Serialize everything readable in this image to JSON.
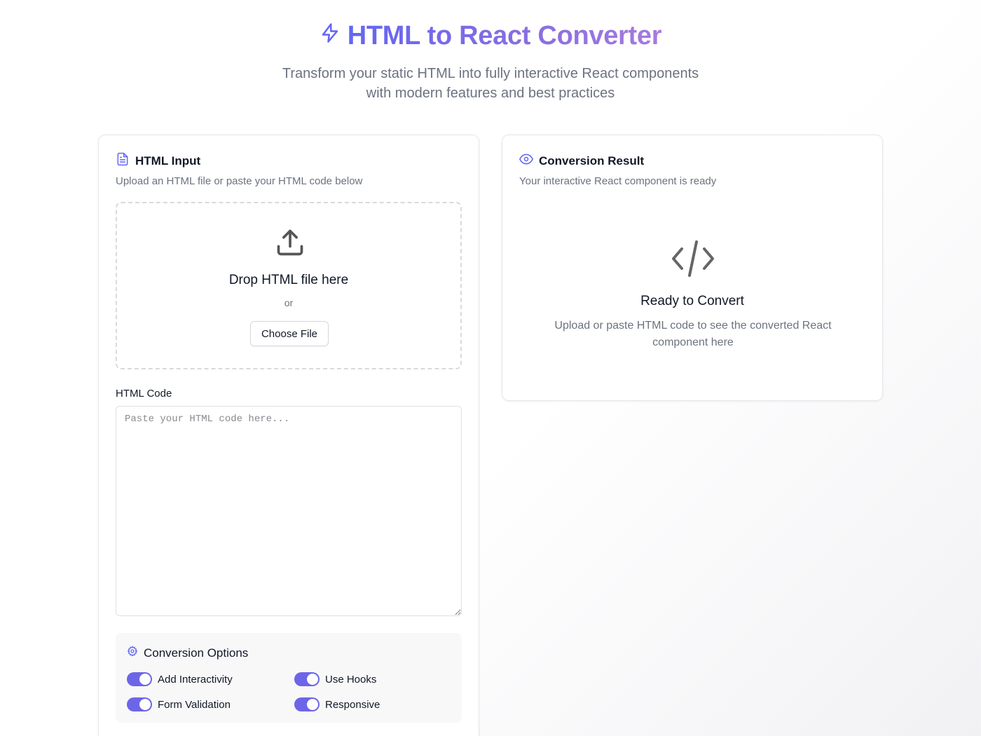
{
  "header": {
    "title": "HTML to React Converter",
    "subtitle_line1": "Transform your static HTML into fully interactive React components",
    "subtitle_line2": "with modern features and best practices"
  },
  "input_panel": {
    "title": "HTML Input",
    "description": "Upload an HTML file or paste your HTML code below",
    "dropzone": {
      "title": "Drop HTML file here",
      "or_text": "or",
      "button_label": "Choose File"
    },
    "code_label": "HTML Code",
    "code_value": "",
    "code_placeholder": "Paste your HTML code here..."
  },
  "options": {
    "title": "Conversion Options",
    "items": [
      {
        "label": "Add Interactivity",
        "enabled": true
      },
      {
        "label": "Use Hooks",
        "enabled": true
      },
      {
        "label": "Form Validation",
        "enabled": true
      },
      {
        "label": "Responsive",
        "enabled": true
      }
    ]
  },
  "result_panel": {
    "title": "Conversion Result",
    "description": "Your interactive React component is ready",
    "empty_title": "Ready to Convert",
    "empty_desc_line1": "Upload or paste HTML code to see the converted React",
    "empty_desc_line2": "component here"
  },
  "icons": {
    "title": "lightning-icon",
    "input": "file-text-icon",
    "upload": "upload-icon",
    "options": "settings-icon",
    "result": "eye-icon",
    "empty": "code-icon"
  },
  "colors": {
    "accent": "#6366f1",
    "accent_gradient_end": "#a77ae0",
    "toggle_on": "#6d65e8",
    "muted_text": "#6b7280"
  }
}
